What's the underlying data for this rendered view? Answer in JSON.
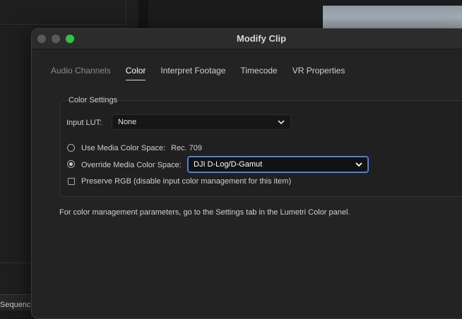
{
  "background": {
    "sequence_label": "Sequence"
  },
  "dialog": {
    "title": "Modify Clip",
    "tabs": [
      {
        "label": "Audio Channels",
        "state": "disabled"
      },
      {
        "label": "Color",
        "state": "active"
      },
      {
        "label": "Interpret Footage",
        "state": "normal"
      },
      {
        "label": "Timecode",
        "state": "normal"
      },
      {
        "label": "VR Properties",
        "state": "normal"
      }
    ],
    "color_settings": {
      "legend": "Color Settings",
      "input_lut_label": "Input LUT:",
      "input_lut_value": "None",
      "use_media_label": "Use Media Color Space:",
      "use_media_value": "Rec. 709",
      "use_media_selected": false,
      "override_label": "Override Media Color Space:",
      "override_value": "DJI D-Log/D-Gamut",
      "override_selected": true,
      "preserve_rgb_label": "Preserve RGB (disable input color management for this item)",
      "preserve_rgb_checked": false
    },
    "note": "For color management parameters, go to the Settings tab in the Lumetri Color panel."
  },
  "colors": {
    "focus_ring": "#5a8dee",
    "maximize": "#2ec641"
  }
}
